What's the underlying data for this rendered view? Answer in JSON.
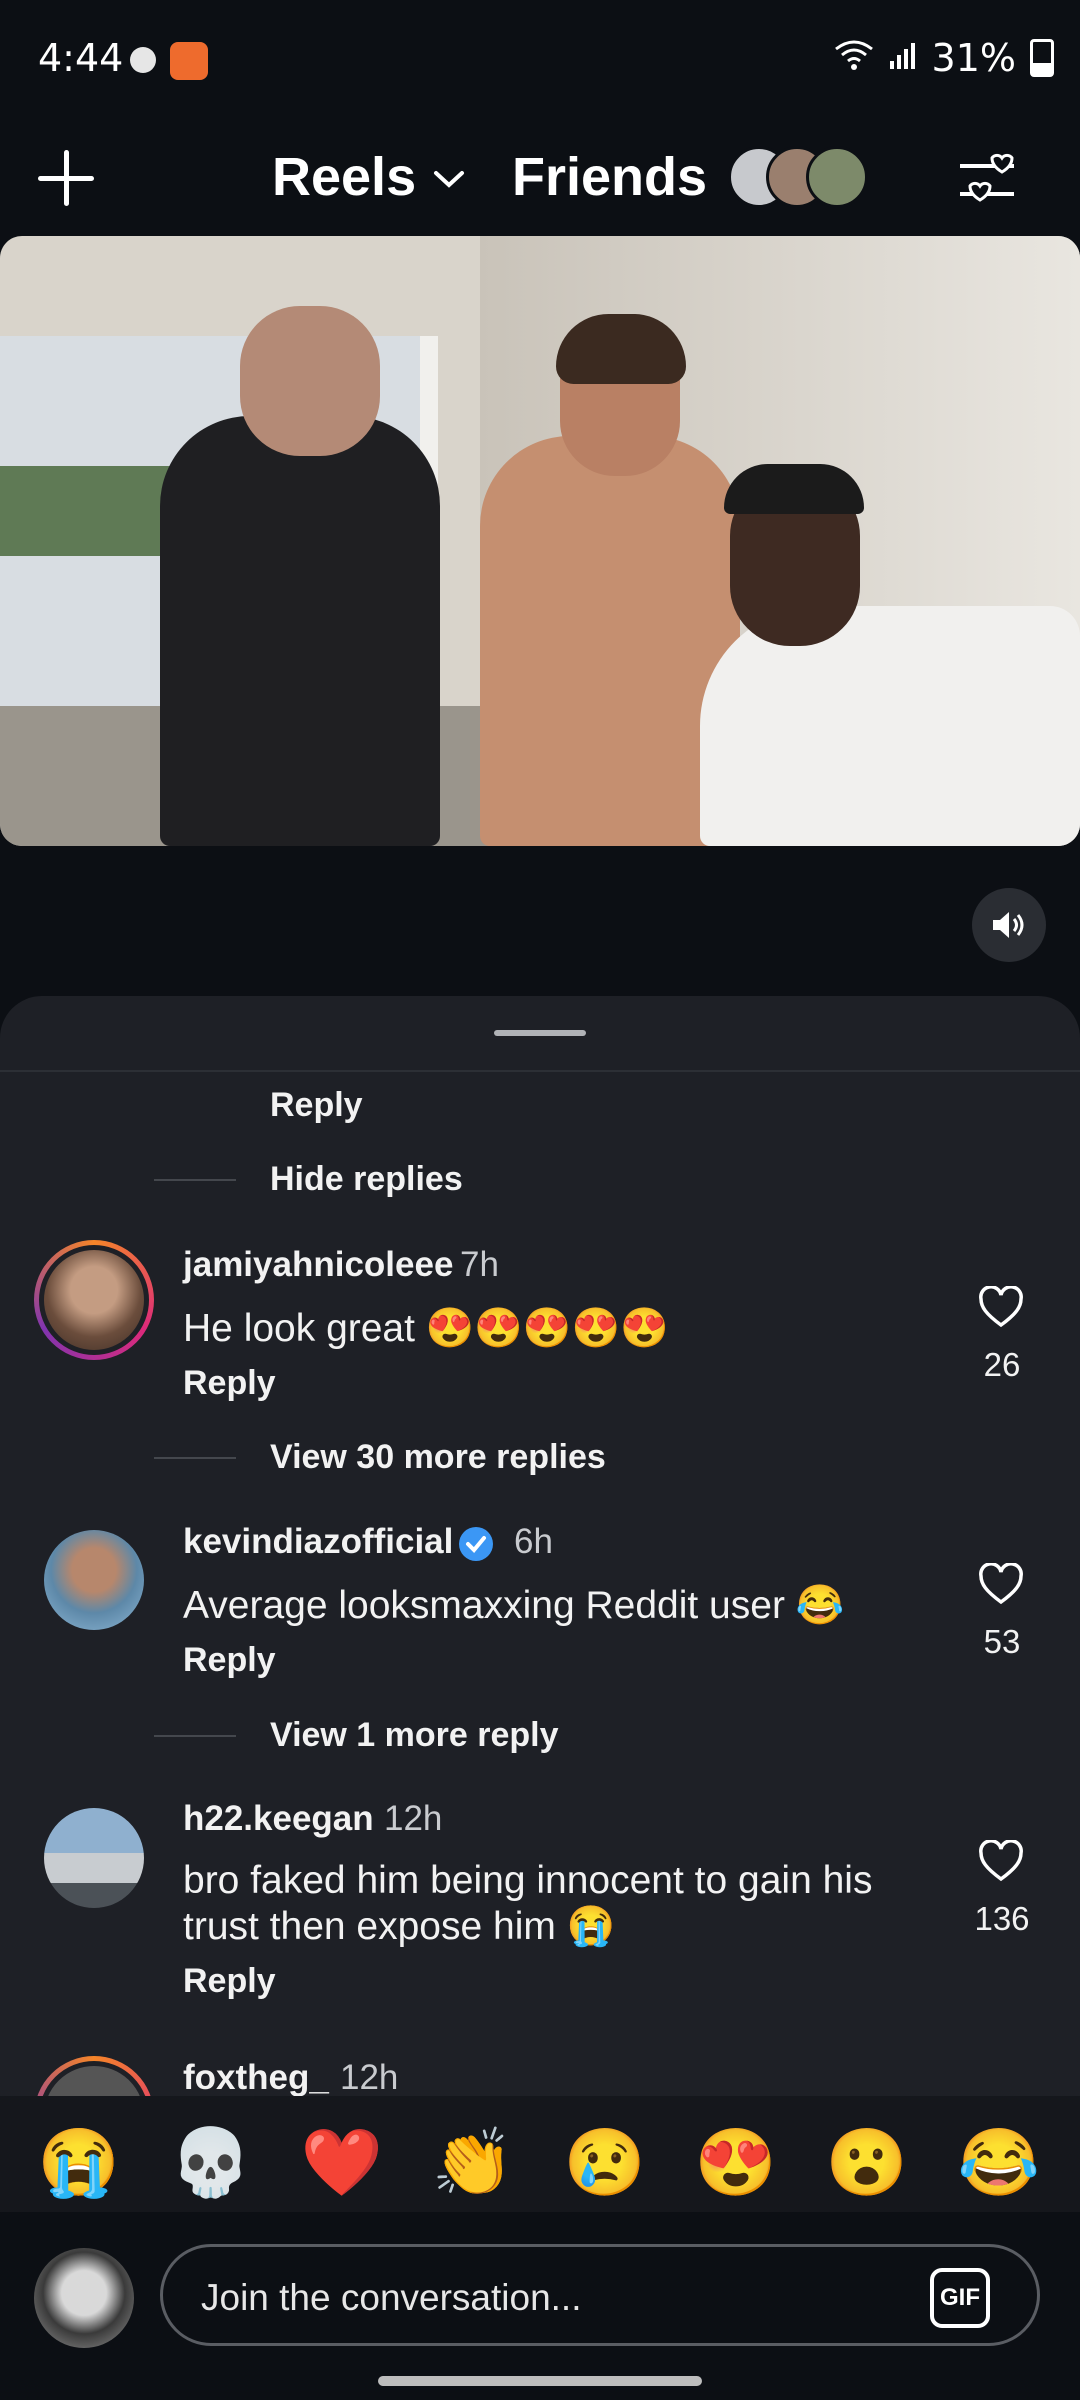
{
  "status_bar": {
    "time": "4:44",
    "battery": "31%"
  },
  "header": {
    "left_tab": "Reels",
    "right_tab": "Friends"
  },
  "comments": {
    "reply_label": "Reply",
    "hide_replies": "Hide replies",
    "items": [
      {
        "username": "jamiyahnicoleee",
        "time": "7h",
        "text": "He look great 😍😍😍😍😍",
        "likes": "26",
        "more": "View 30 more replies"
      },
      {
        "username": "kevindiazofficial",
        "verified": true,
        "time": "6h",
        "text": "Average looksmaxxing Reddit user 😂",
        "likes": "53",
        "more": "View 1 more reply"
      },
      {
        "username": "h22.keegan",
        "time": "12h",
        "text_line1": "bro faked him being innocent to gain his",
        "text_line2": "trust then expose him 😭",
        "likes": "136"
      },
      {
        "username": "foxtheg_",
        "time": "12h"
      }
    ]
  },
  "emoji_bar": [
    "😭",
    "💀",
    "❤️",
    "👏",
    "😢",
    "😍",
    "😮",
    "😂"
  ],
  "input": {
    "placeholder": "Join the conversation...",
    "gif_label": "GIF"
  },
  "colors": {
    "background": "#0c0f14",
    "sheet": "#1e2026",
    "verified": "#3b97f5"
  },
  "icons": [
    "plus-icon",
    "chevron-down-icon",
    "filter-hearts-icon",
    "volume-icon",
    "heart-icon",
    "verified-badge-icon",
    "gif-icon"
  ]
}
